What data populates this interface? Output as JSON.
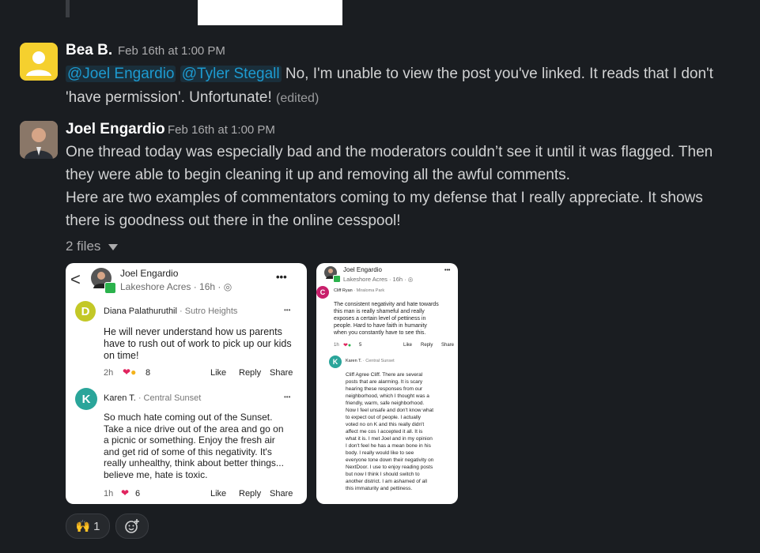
{
  "messages": [
    {
      "author": "Bea B.",
      "timestamp": "Feb 16th at 1:00 PM",
      "mention1": "@Joel Engardio",
      "mention2": "@Tyler Stegall",
      "text_line1": " No, I'm unable to view the post you've linked. It reads that I don't",
      "text_line2": "'have permission'. Unfortunate!",
      "edited": "(edited)"
    },
    {
      "author": "Joel Engardio",
      "timestamp": "Feb 16th at 1:00 PM",
      "lines": [
        "One thread today was especially bad and the moderators couldn’t see it until it was flagged. Then",
        "they were able to begin cleaning it up and removing all the awful comments.",
        "Here are two examples of commentators coming to my defense that I really appreciate. It shows",
        "there is goodness out there in the online cesspool!"
      ],
      "files_label": "2 files"
    }
  ],
  "card1": {
    "back": "<",
    "poster": "Joel Engardio",
    "sub": "Lakeshore Acres · 16h · ",
    "more": "•••",
    "c1_initial": "D",
    "c1_name": "Diana Palathuruthil",
    "c1_loc": " · Sutro Heights",
    "c1_text": [
      "He will never understand how us parents",
      "have to rush out of work to pick up our kids",
      "on time!"
    ],
    "c1_time": "2h",
    "c1_count": "8",
    "like": "Like",
    "reply": "Reply",
    "share": "Share",
    "c2_initial": "K",
    "c2_name": "Karen T.",
    "c2_loc": " · Central Sunset",
    "c2_text": [
      "So much hate coming out of the Sunset.",
      "Take a nice drive out of the area and go on",
      "a picnic or something.  Enjoy the fresh air",
      "and get rid of some of this negativity.  It's",
      "really unhealthy, think about better things...",
      "believe me, hate is toxic."
    ],
    "c2_time": "1h",
    "c2_count": "6"
  },
  "card2": {
    "poster": "Joel Engardio",
    "sub": "Lakeshore Acres · 16h · ",
    "more": "•••",
    "c1_initial": "C",
    "c1_name": "Cliff Ryan",
    "c1_loc": " · Miraloma Park",
    "c1_text": [
      "The consistent negativity and hate towards",
      "this man is really shameful and really",
      "exposes a certain level of pettiness in",
      "people. Hard to have faith in humanity",
      "when you constantly have to see this."
    ],
    "c1_time": "1h",
    "c1_count": "5",
    "like": "Like",
    "reply": "Reply",
    "share": "Share",
    "c2_initial": "K",
    "c2_name": "Karen T.",
    "c2_loc": " · Central Sunset",
    "c2_text": [
      "Cliff Agree Cliff.  There are several",
      "posts that are alarming.  It is scary",
      "hearing these responses from our",
      "neighborhood, which I thought was a",
      "friendly, warm, safe neighborhood.",
      "Now I feel unsafe and don't know what",
      "to expect out of people.  I actually",
      "voted no on K and this really didn't",
      "affect me cos I accepted it all.  It is",
      "what it is.  I met Joel and in my opinion",
      "I don't feel he has a mean bone in his",
      "body.  I really would like to see",
      "everyone tone down their negativity on",
      "NextDoor.  I use to enjoy reading posts",
      "but now I think I should switch to",
      "another district.  I am ashamed of all",
      "this immaturity and pettiness."
    ]
  },
  "reactions": {
    "emoji": "🙌",
    "count": "1",
    "add_icon": "add-reaction-icon"
  },
  "colors": {
    "background": "#1a1d21",
    "mention": "#1d9bd1",
    "avatar_bea": "#f5d02e",
    "diana": "#c3c827",
    "karen": "#2aa59a",
    "cliff": "#c81f6b"
  }
}
